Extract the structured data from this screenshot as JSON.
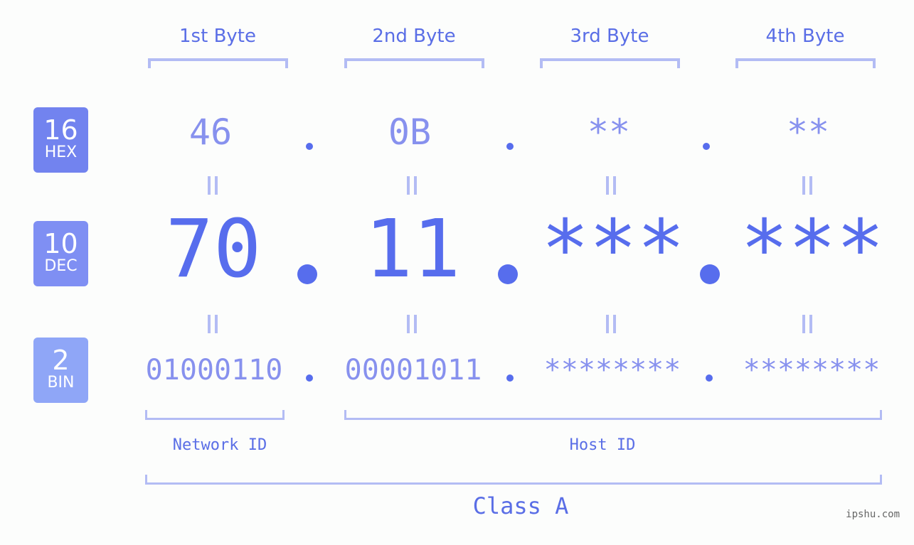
{
  "byte_headers": [
    "1st Byte",
    "2nd Byte",
    "3rd Byte",
    "4th Byte"
  ],
  "bases": [
    {
      "number": "16",
      "label": "HEX",
      "color": "#7283ef"
    },
    {
      "number": "10",
      "label": "DEC",
      "color": "#7f8ff3"
    },
    {
      "number": "2",
      "label": "BIN",
      "color": "#8fa6f7"
    }
  ],
  "hex": [
    "46",
    "0B",
    "**",
    "**"
  ],
  "dec": [
    "70",
    "11",
    "***",
    "***"
  ],
  "bin": [
    "01000110",
    "00001011",
    "********",
    "********"
  ],
  "separator": ".",
  "groups": {
    "network_id": "Network ID",
    "host_id": "Host ID",
    "class": "Class A"
  },
  "colors": {
    "accent": "#576ded",
    "light_accent": "#8791ee",
    "bracket": "#b3bcf4",
    "background": "#fcfdfc"
  },
  "watermark": "ipshu.com"
}
